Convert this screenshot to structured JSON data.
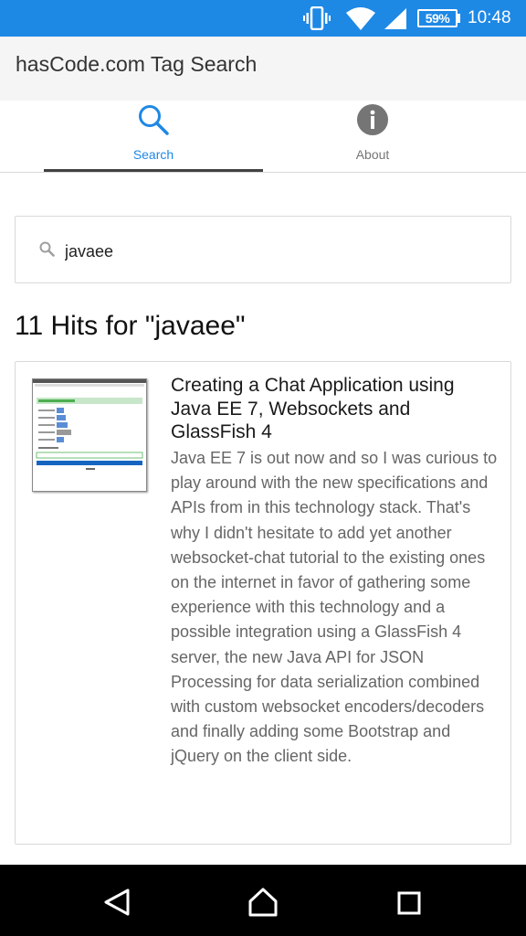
{
  "status_bar": {
    "battery": "59%",
    "time": "10:48",
    "icons": [
      "vibrate-icon",
      "wifi-icon",
      "signal-icon",
      "battery-icon"
    ]
  },
  "app_bar": {
    "title": "hasCode.com Tag Search"
  },
  "tabs": [
    {
      "label": "Search",
      "icon": "search-icon",
      "active": true
    },
    {
      "label": "About",
      "icon": "info-icon",
      "active": false
    }
  ],
  "search": {
    "value": "javaee",
    "icon": "search-icon"
  },
  "results_heading": "11 Hits for \"javaee\"",
  "results": [
    {
      "title": "Creating a Chat Application using Java EE 7, Websockets and GlassFish 4",
      "description": "Java EE 7 is out now and so I was curious to play around with the new specifications and APIs from in this technology stack.  That's why I didn't hesitate to add yet another websocket-chat tutorial to the existing ones on the internet in favor of gathering some experience with this technology and a possible integration using a GlassFish 4 server, the new Java API for JSON Processing for data serialization combined with custom websocket encoders/decoders and finally adding some Bootstrap and jQuery on the client side."
    }
  ],
  "colors": {
    "status_bar": "#1e88e5",
    "active_tab": "#1e88e5",
    "app_bar": "#f5f5f5",
    "nav_bar": "#000000"
  },
  "nav_bar": {
    "icons": [
      "back-icon",
      "home-icon",
      "recents-icon"
    ]
  }
}
